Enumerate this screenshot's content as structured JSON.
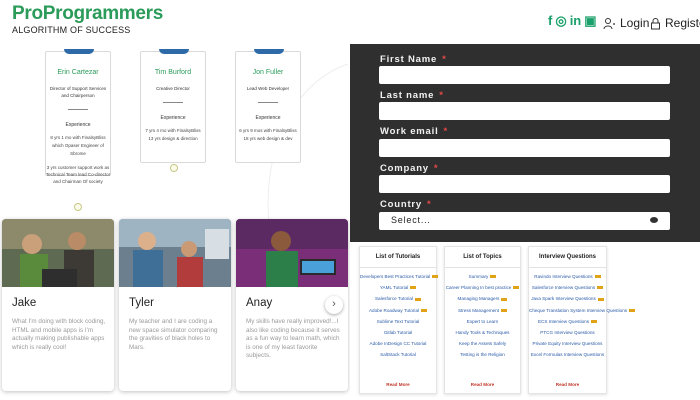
{
  "brand": {
    "title": "ProProgrammers",
    "tagline": "ALGORITHM OF SUCCESS",
    "color": "#2b9b5a"
  },
  "social": [
    "f",
    "◎",
    "in",
    "▣"
  ],
  "nav": {
    "login": "Login",
    "register": "Register"
  },
  "team": [
    {
      "name": "Erin Cartezar",
      "role": "Director of Support Services and Chairperson",
      "experience": "Experience",
      "desc": "8 yrs 1 mo with FinalsyBliss which Opaser Engineer of Sbrome",
      "extra": "3 yrs customer support work as Technical Team lead Co-director and Chairman Of society"
    },
    {
      "name": "Tim Burford",
      "role": "Creative Director",
      "experience": "Experience",
      "desc": "7 yrs 4 mo with FinalsyBliss 13 yrs design & direction",
      "extra": ""
    },
    {
      "name": "Jon Fuller",
      "role": "Lead Web Developer",
      "experience": "Experience",
      "desc": "6 yrs 9 mos with FinalsyBliss 18 yrs web design & dev",
      "extra": ""
    }
  ],
  "stories": [
    {
      "name": "Jake",
      "quote": "What I'm doing with block coding, HTML and mobile apps is I'm actually making publishable apps which is really cool!"
    },
    {
      "name": "Tyler",
      "quote": "My teacher and I are coding a new space simulator comparing the gravities of black holes to Mars."
    },
    {
      "name": "Anay",
      "quote": "My skills have really improved!...I also like coding because it serves as a fun way to learn math, which is one of my least favorite subjects."
    }
  ],
  "next_arrow": "›",
  "form": {
    "first_name": "First Name",
    "last_name": "Last name",
    "work_email": "Work email",
    "company": "Company",
    "country": "Country",
    "required": "*",
    "country_select": "Select..."
  },
  "panels": [
    {
      "title": "List of Tutorials",
      "items": [
        "Developers Best Practices Tutorial",
        "YAML Tutorial",
        "Salesforce Tutorial",
        "Adobe Roadway Tutorial",
        "Sublime Text Tutorial",
        "Gitlab Tutorial",
        "Adobe InDesign CC Tutorial",
        "SaltStack Tutorial"
      ],
      "hot": [
        true,
        true,
        true,
        true,
        false,
        false,
        false,
        false
      ],
      "read_more": "Read More"
    },
    {
      "title": "List of Topics",
      "items": [
        "Summary",
        "Career Planning In best practice",
        "Managing Managers",
        "Stress Management",
        "Expert to Learn",
        "Handy Tools & Techniques",
        "Keep the Assets Safely",
        "Testing is the Religion"
      ],
      "hot": [
        true,
        true,
        true,
        true,
        false,
        false,
        false,
        false
      ],
      "read_more": "Read More"
    },
    {
      "title": "Interview Questions",
      "items": [
        "Ravindo Interview Questions",
        "Salesforce Interview Questions",
        "Java Spark Interview Questions",
        "Cheque Translation System Interview Questions",
        "ECS Interview Questions",
        "PTCG Interview Questions",
        "Private Equity Interview Questions",
        "Excel Formulas Interview Questions"
      ],
      "hot": [
        true,
        true,
        true,
        true,
        true,
        false,
        false,
        false
      ],
      "read_more": "Read More"
    }
  ]
}
